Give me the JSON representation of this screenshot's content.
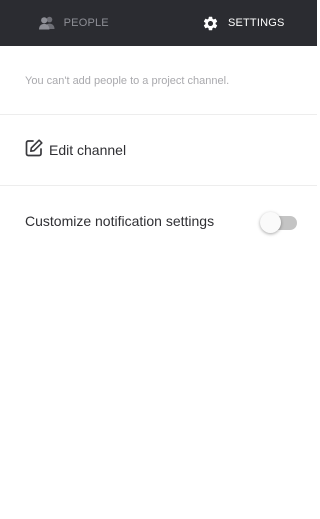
{
  "tabs": {
    "people": {
      "label": "PEOPLE",
      "icon": "people-icon",
      "active": false
    },
    "settings": {
      "label": "SETTINGS",
      "icon": "gear-icon",
      "active": true
    }
  },
  "notice": "You can't add people to a project channel.",
  "edit_channel": {
    "label": "Edit channel",
    "icon": "edit-icon"
  },
  "notifications": {
    "label": "Customize notification settings",
    "enabled": false
  },
  "colors": {
    "tabbar_bg": "#2b2c31",
    "tab_inactive": "#8e8f96",
    "tab_active": "#ffffff",
    "toggle_off": "#c4c4c4"
  }
}
